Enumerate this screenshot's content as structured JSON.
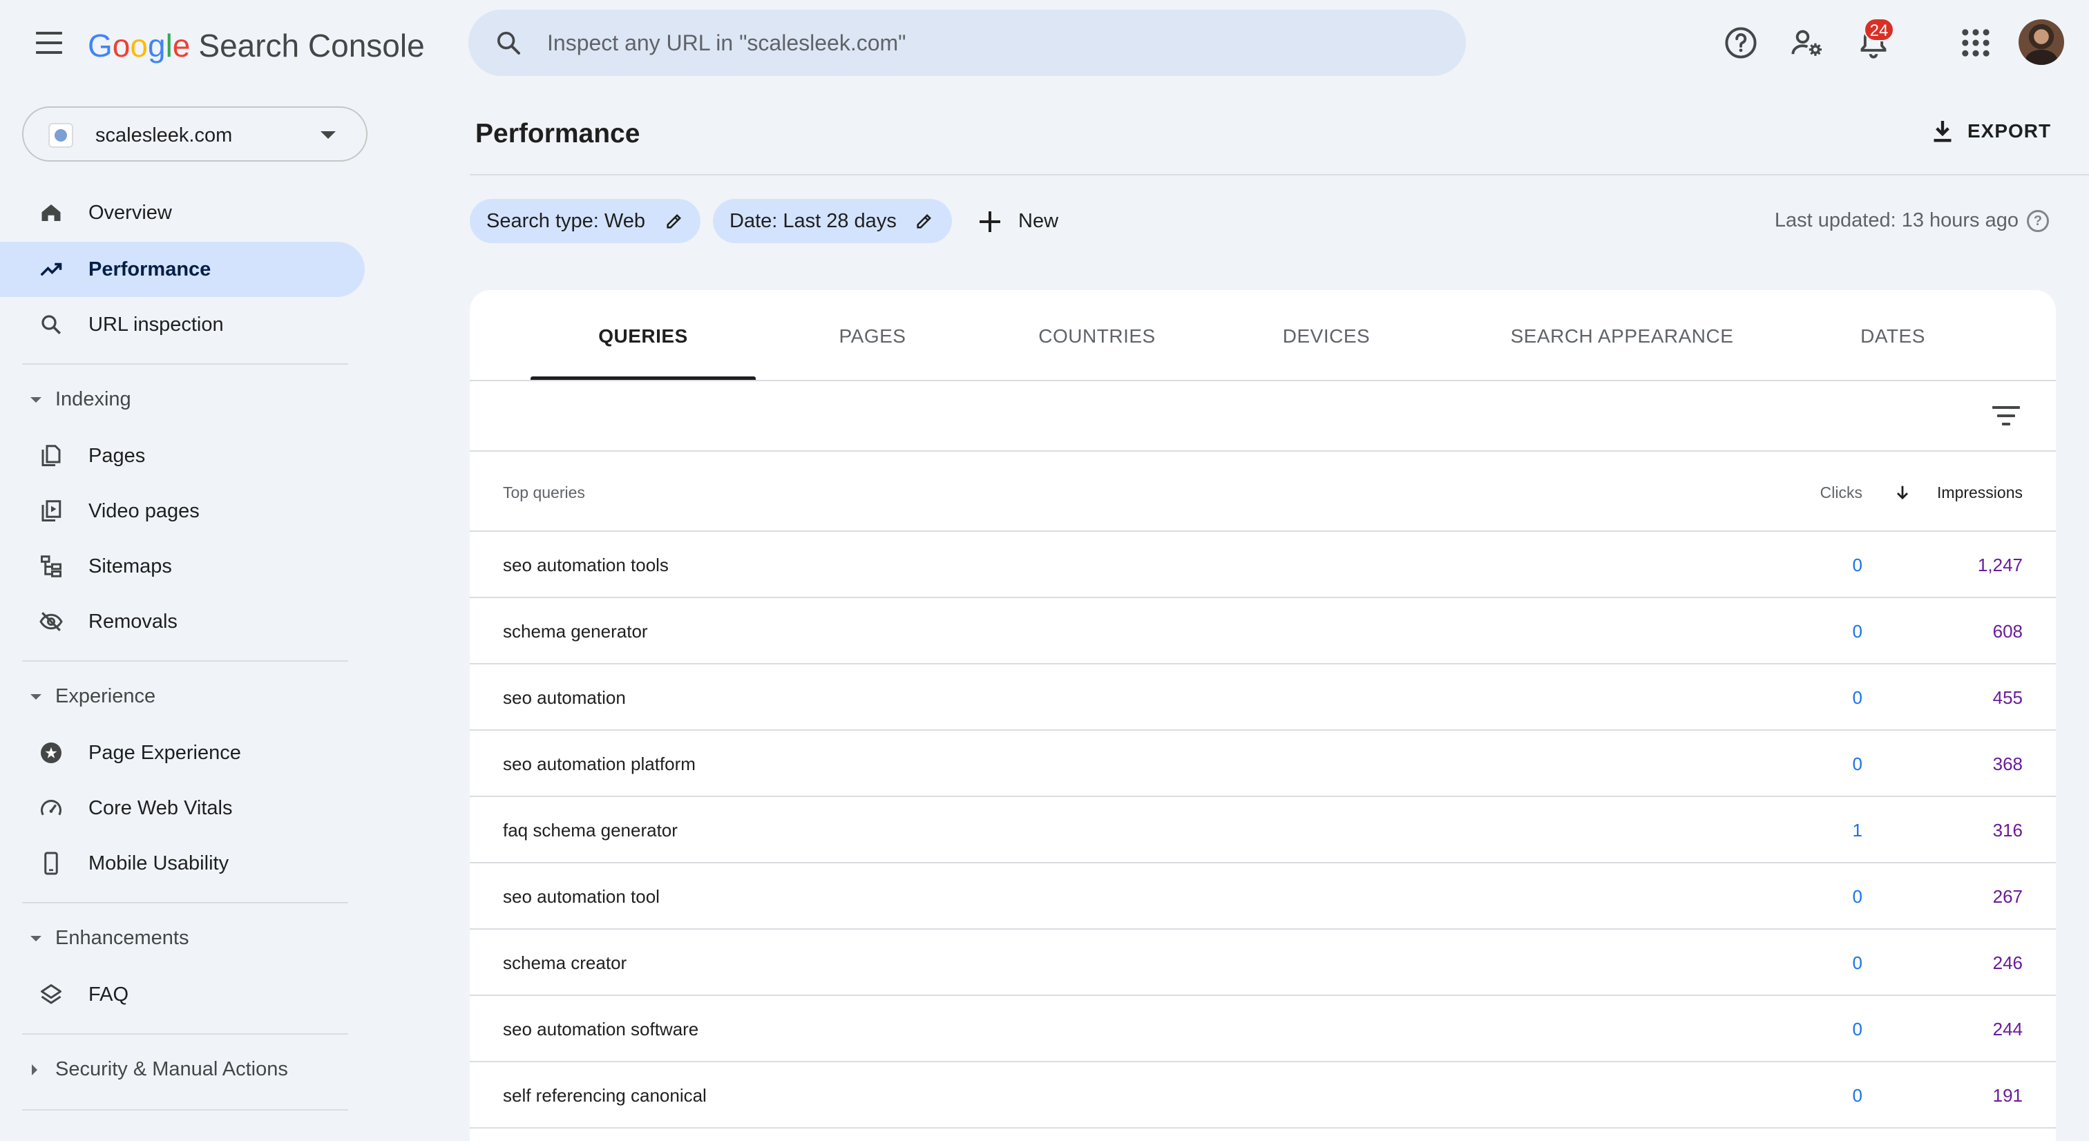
{
  "app": {
    "logo_letters": [
      "G",
      "o",
      "o",
      "g",
      "l",
      "e"
    ],
    "logo_colors": [
      "#4285f4",
      "#ea4335",
      "#fbbc05",
      "#4285f4",
      "#34a853",
      "#ea4335"
    ],
    "product": "Search Console"
  },
  "search": {
    "placeholder": "Inspect any URL in \"scalesleek.com\""
  },
  "topbar": {
    "notification_count": "24"
  },
  "property": {
    "name": "scalesleek.com"
  },
  "sidebar": {
    "items": [
      {
        "label": "Overview",
        "icon": "home-icon"
      },
      {
        "label": "Performance",
        "icon": "trending-up-icon"
      },
      {
        "label": "URL inspection",
        "icon": "search-icon"
      }
    ],
    "sections": [
      {
        "label": "Indexing",
        "items": [
          {
            "label": "Pages",
            "icon": "pages-icon"
          },
          {
            "label": "Video pages",
            "icon": "video-pages-icon"
          },
          {
            "label": "Sitemaps",
            "icon": "sitemap-icon"
          },
          {
            "label": "Removals",
            "icon": "eye-off-icon"
          }
        ]
      },
      {
        "label": "Experience",
        "items": [
          {
            "label": "Page Experience",
            "icon": "star-badge-icon"
          },
          {
            "label": "Core Web Vitals",
            "icon": "speedometer-icon"
          },
          {
            "label": "Mobile Usability",
            "icon": "phone-icon"
          }
        ]
      },
      {
        "label": "Enhancements",
        "items": [
          {
            "label": "FAQ",
            "icon": "layers-icon"
          }
        ]
      },
      {
        "label": "Security & Manual Actions",
        "items": []
      }
    ]
  },
  "header": {
    "title": "Performance",
    "export_label": "EXPORT",
    "last_updated": "Last updated: 13 hours ago"
  },
  "filters": {
    "chips": [
      "Search type: Web",
      "Date: Last 28 days"
    ],
    "new_label": "New"
  },
  "tabs": [
    "QUERIES",
    "PAGES",
    "COUNTRIES",
    "DEVICES",
    "SEARCH APPEARANCE",
    "DATES"
  ],
  "table": {
    "headers": {
      "query": "Top queries",
      "clicks": "Clicks",
      "impressions": "Impressions"
    },
    "rows": [
      {
        "query": "seo automation tools",
        "clicks": "0",
        "impressions": "1,247"
      },
      {
        "query": "schema generator",
        "clicks": "0",
        "impressions": "608"
      },
      {
        "query": "seo automation",
        "clicks": "0",
        "impressions": "455"
      },
      {
        "query": "seo automation platform",
        "clicks": "0",
        "impressions": "368"
      },
      {
        "query": "faq schema generator",
        "clicks": "1",
        "impressions": "316"
      },
      {
        "query": "seo automation tool",
        "clicks": "0",
        "impressions": "267"
      },
      {
        "query": "schema creator",
        "clicks": "0",
        "impressions": "246"
      },
      {
        "query": "seo automation software",
        "clicks": "0",
        "impressions": "244"
      },
      {
        "query": "self referencing canonical",
        "clicks": "0",
        "impressions": "191"
      }
    ]
  }
}
